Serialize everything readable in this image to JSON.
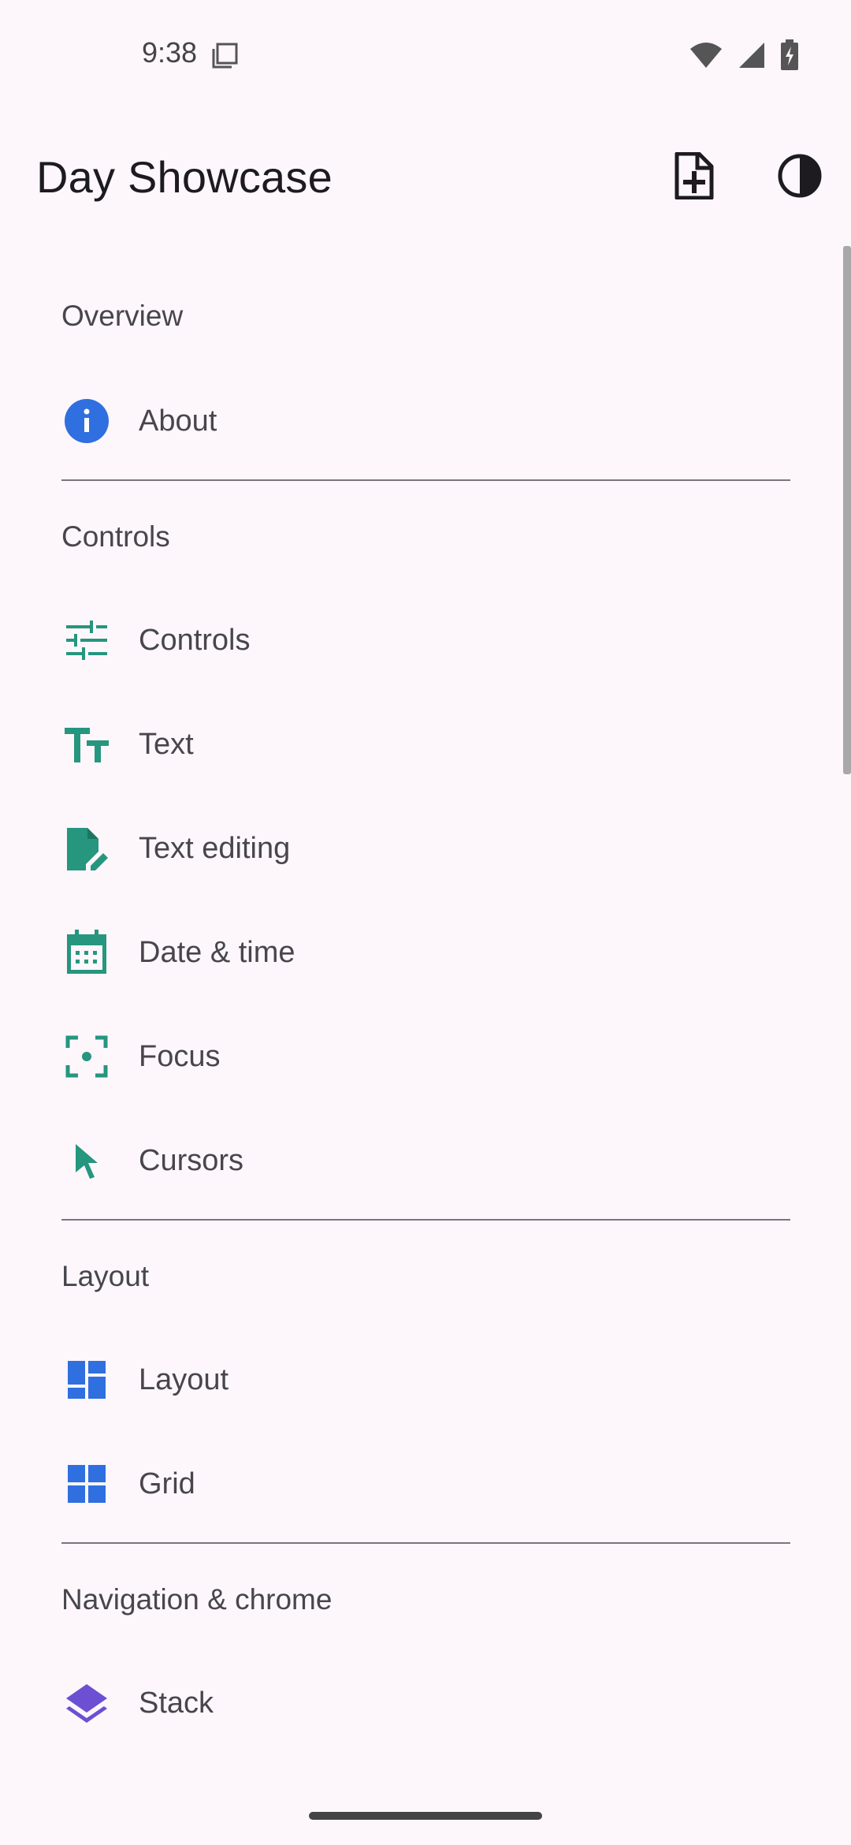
{
  "status": {
    "time": "9:38"
  },
  "app_bar": {
    "title": "Day Showcase"
  },
  "sections": {
    "overview": {
      "header": "Overview",
      "items": [
        "About"
      ]
    },
    "controls": {
      "header": "Controls",
      "items": [
        "Controls",
        "Text",
        "Text editing",
        "Date & time",
        "Focus",
        "Cursors"
      ]
    },
    "layout": {
      "header": "Layout",
      "items": [
        "Layout",
        "Grid"
      ]
    },
    "navigation": {
      "header": "Navigation & chrome",
      "items": [
        "Stack"
      ]
    }
  },
  "colors": {
    "teal": "#26967e",
    "blue": "#2f6fe0",
    "purple": "#6c4fd2"
  },
  "icons": {
    "status_bar": [
      "screen-capture-icon",
      "wifi-icon",
      "signal-icon",
      "battery-charging-icon"
    ],
    "app_bar": [
      "new-document-icon",
      "theme-contrast-icon"
    ],
    "items": [
      "info-icon",
      "tune-icon",
      "text-fields-icon",
      "edit-document-icon",
      "calendar-icon",
      "focus-center-icon",
      "cursor-arrow-icon",
      "dashboard-icon",
      "grid-icon",
      "layers-icon"
    ]
  }
}
